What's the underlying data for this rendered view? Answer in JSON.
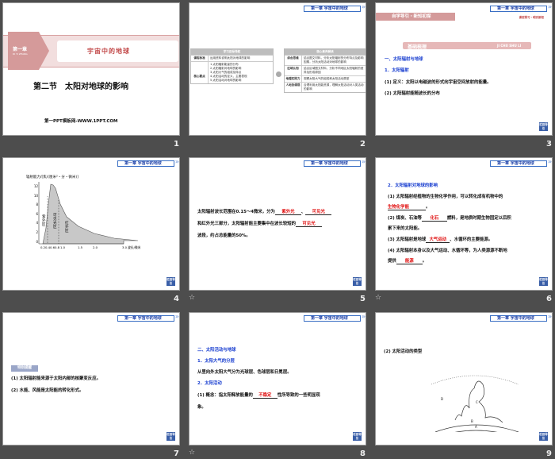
{
  "header_tag": "第一章 宇宙中的地球",
  "back_button": "栏目导引",
  "slide_numbers": [
    "1",
    "2",
    "3",
    "4",
    "5",
    "6",
    "7",
    "8",
    "9"
  ],
  "slide1": {
    "chapter_badge": "第一章",
    "chapter_pinyin": "DI YI ZHANG",
    "chapter_title": "宇宙中的地球",
    "section_title": "第二节　太阳对地球的影响",
    "footer": "第一PPT模板网-WWW.1PPT.COM"
  },
  "slide2": {
    "left_header": "学习目标导航",
    "left_rows": [
      {
        "k": "课程标准",
        "v": "运用资料说明太阳对地球的影响"
      },
      {
        "k": "核心要点",
        "v": "1.太阳辐射能量的分布\n2.太阳辐射对地球的影响\n3.太阳大气的组成及特点\n4.太阳活动的定义、主要表现\n5.太阳活动对地球的影响"
      }
    ],
    "right_header": "核心素养解读",
    "right_rows": [
      {
        "k": "综合思维",
        "v": "结合图文材料，分析太阳辐射的分布特点及影响因素，分析太阳活动对地球的影响"
      },
      {
        "k": "区域认知",
        "v": "结合区域图文材料，分析不同地区太阳辐射的差异及形成原因"
      },
      {
        "k": "地理实践力",
        "v": "观察太阳大气的组成和太阳活动类型"
      },
      {
        "k": "人地协调观",
        "v": "合理利用太阳能资源，理解太阳活动对人类活动的影响"
      }
    ]
  },
  "slide3": {
    "banner": "自学导引・新知初探",
    "sub": "课前预习・明实新知",
    "section_label": "基础梳理",
    "section_pinyin": "JI CHU SHU LI",
    "h1": "一、太阳辐射与地球",
    "h2": "1．太阳辐射",
    "p1": "(1) 定义：太阳以电磁波的形式向宇宙空间放射的能量。",
    "p2": "(2) 太阳辐射能随波长的分布"
  },
  "slide4": {
    "ylabel": "辐射能力/[焦/(厘米²・分・微米)]",
    "yticks": [
      "12",
      "10",
      "8",
      "6",
      "4",
      "2",
      "0"
    ],
    "xticks": [
      "0.2",
      "0.4",
      "0.6",
      "0.8",
      "1.0",
      "1.5",
      "2.0",
      "3.0"
    ],
    "xlabel": "波长/微米",
    "zone_uv": "紫外区",
    "zone_vis": "可见光区",
    "zone_ir": "红外区"
  },
  "slide5": {
    "l1a": "太阳辐射波长范围在0.15～4微米，分为",
    "a1": "紫外光",
    "l1b": "、",
    "a2": "可见光",
    "l2a": "和红外光三部分，太阳辐射能主要集中在波长较短的",
    "a3": "可见光",
    "l3": "波段，约占总能量的50%。"
  },
  "slide6": {
    "h": "2．太阳辐射对地球的影响",
    "p1": "(1) 太阳辐射经植物的生物化学作用，可以转化成有机物中的",
    "a1": "生物化学能",
    "p1end": "。",
    "p2a": "(2) 煤炭、石油等",
    "a2": "化石",
    "p2b": "燃料，是地质时期生物固定以后积",
    "p2c": "累下来的太阳能。",
    "p3a": "(3) 太阳辐射是地球",
    "a3": "大气运动",
    "p3b": "、水循环的主要能源。",
    "p4a": "(4) 太阳辐射本身以及大气运动、水循环等，为人类源源不断地",
    "p4b": "提供",
    "a4": "能源",
    "p4end": "。"
  },
  "slide7": {
    "badge": "特别提醒",
    "p1": "(1) 太阳辐射能来源于太阳内部的核聚变反应。",
    "p2": "(2) 水能、风能是太阳能的转化形式。"
  },
  "slide8": {
    "h1": "二、太阳活动与地球",
    "h2": "1．太阳大气的分层",
    "p1": "从里向外太阳大气分为光球层、色球层和日冕层。",
    "h3": "2．太阳活动",
    "p2a": "(1) 概念：指太阳释放能量的",
    "a1": "不稳定",
    "p2b": "性所导致的一些明显现",
    "p2c": "象。"
  },
  "slide9": {
    "p": "(2) 太阳活动的类型",
    "labels": [
      "A",
      "B",
      "C",
      "D"
    ]
  }
}
